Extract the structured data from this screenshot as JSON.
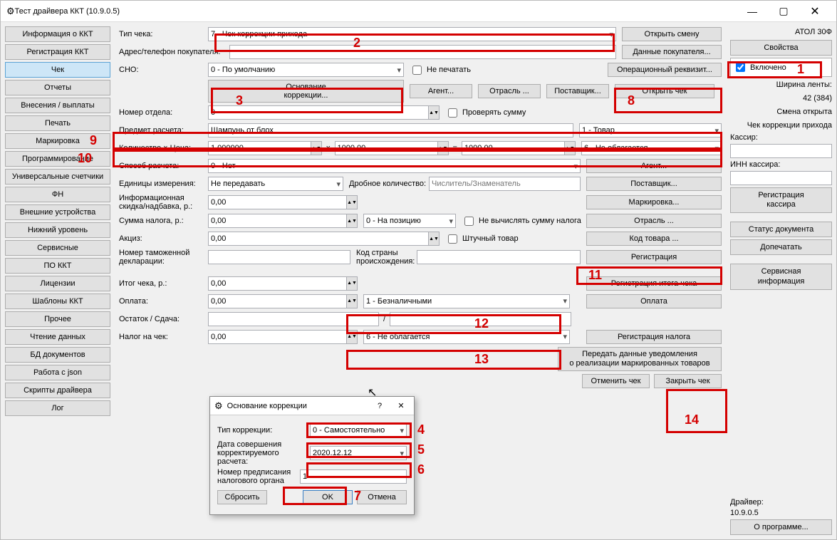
{
  "window": {
    "title": "Тест драйвера ККТ (10.9.0.5)"
  },
  "left_nav": [
    "Информация о ККТ",
    "Регистрация ККТ",
    "Чек",
    "Отчеты",
    "Внесения / выплаты",
    "Печать",
    "Маркировка",
    "Программирование",
    "Универсальные счетчики",
    "ФН",
    "Внешние устройства",
    "Нижний уровень",
    "Сервисные",
    "ПО ККТ",
    "Лицензии",
    "Шаблоны ККТ",
    "Прочее",
    "Чтение данных",
    "БД документов",
    "Работа с json",
    "Скрипты драйвера",
    "Лог"
  ],
  "left_active_idx": 2,
  "center": {
    "tip_cheka_label": "Тип чека:",
    "tip_cheka_value": "7 - Чек коррекции прихода",
    "open_shift": "Открыть смену",
    "addr_label": "Адрес/телефон покупателя:",
    "addr_value": "",
    "buyer_data": "Данные покупателя...",
    "sno_label": "СНО:",
    "sno_value": "0 - По умолчанию",
    "ne_pechatat": "Не печатать",
    "oper_rekv": "Операционный реквизит...",
    "osnovanie": "Основание\nкоррекции...",
    "agent": "Агент...",
    "otrasl": "Отрасль ...",
    "postavshik": "Поставщик...",
    "open_check": "Открыть чек",
    "nomer_otdela_label": "Номер отдела:",
    "nomer_otdela_value": "0",
    "check_sum": "Проверять сумму",
    "predmet_label": "Предмет расчета:",
    "predmet_value": "Шампунь от блох",
    "predmet_type": "1 - Товар",
    "qty_label": "Количество × Цена:",
    "qty_value": "1,000000",
    "mult": "x",
    "price_value": "1000,00",
    "eq": "=",
    "sum_value": "1000,00",
    "nds_value": "6 - Не облагается",
    "sposob_label": "Способ расчета:",
    "sposob_value": "0 - Нет",
    "agent2": "Агент...",
    "units_label": "Единицы измерения:",
    "units_value": "Не передавать",
    "drob_label": "Дробное количество:",
    "drob_placeholder": "Числитель/Знаменатель",
    "postavshik2": "Поставщик...",
    "skidka_label": "Информационная\nскидка/надбавка, р.:",
    "skidka_value": "0,00",
    "markirovka": "Маркировка...",
    "nalog_label": "Сумма налога, р.:",
    "nalog_value": "0,00",
    "nalog_pos": "0 - На позицию",
    "ne_vychisl": "Не вычислять сумму налога",
    "otrasl2": "Отрасль ...",
    "akciz_label": "Акциз:",
    "akciz_value": "0,00",
    "shtuchnyy": "Штучный товар",
    "kod_tovara": "Код товара ...",
    "tamo_label": "Номер таможенной\nдекларации:",
    "kod_strany_label": "Код страны\nпроисхождения:",
    "registraciya": "Регистрация",
    "itog_label": "Итог чека, р.:",
    "itog_value": "0,00",
    "reg_itoga": "Регистрация итога чека",
    "oplata_label": "Оплата:",
    "oplata_value": "0,00",
    "oplata_type": "1 - Безналичными",
    "oplata_btn": "Оплата",
    "ostatok_label": "Остаток / Сдача:",
    "ostatok_sep": "/",
    "nalog_chek_label": "Налог на чек:",
    "nalog_chek_value": "0,00",
    "nalog_chek_type": "6 - Не облагается",
    "reg_naloga": "Регистрация налога",
    "peredat": "Передать данные уведомления\nо реализации маркированных товаров",
    "otmenit": "Отменить чек",
    "zakryt": "Закрыть чек"
  },
  "right": {
    "device": "АТОЛ 30Ф",
    "svoystva": "Свойства",
    "vklyucheno": "Включено",
    "shirina_label": "Ширина ленты:",
    "shirina_value": "42 (384)",
    "smena": "Смена открыта",
    "chek_type": "Чек коррекции прихода",
    "kassir_label": "Кассир:",
    "inn_label": "ИНН кассира:",
    "reg_kassira": "Регистрация\nкассира",
    "status_doc": "Статус документа",
    "dopechatat": "Допечатать",
    "servis_info": "Сервисная\nинформация",
    "driver_label": "Драйвер:",
    "driver_ver": "10.9.0.5",
    "o_programme": "О программе..."
  },
  "dialog": {
    "title": "Основание коррекции",
    "tip_label": "Тип коррекции:",
    "tip_value": "0 - Самостоятельно",
    "date_label": "Дата совершения\nкорректируемого расчета:",
    "date_value": "2020.12.12",
    "nomer_label": "Номер предписания\nналогового органа",
    "nomer_value": "1",
    "sbrosit": "Сбросить",
    "ok": "OK",
    "otmena": "Отмена"
  }
}
